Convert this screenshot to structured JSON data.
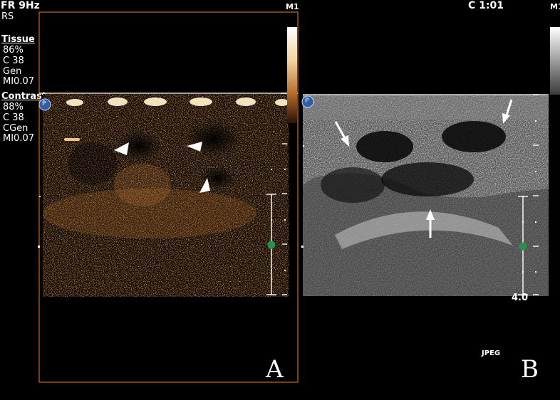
{
  "header": {
    "frame_rate": "FR 9Hz",
    "clock": "C 1:01",
    "marker_left": "M1",
    "marker_right": "M1"
  },
  "settings": {
    "rs": "RS",
    "tissue_title": "Tissue",
    "tissue_lines": [
      "86%",
      "C 38",
      "Gen",
      "MI0.07"
    ],
    "contrast_title": "Contrast",
    "contrast_lines": [
      "88%",
      "C 38",
      "CGen",
      "MI0.07"
    ]
  },
  "panel_a": {
    "label": "A",
    "probe_badge": "P",
    "annotation_icons": [
      "arrowhead-icon",
      "arrowhead-icon",
      "arrowhead-icon"
    ]
  },
  "panel_b": {
    "label": "B",
    "probe_badge": "P",
    "depth_value": "4.0",
    "format_label": "JPEG",
    "annotation_icons": [
      "arrow-icon",
      "arrow-icon",
      "arrow-icon"
    ]
  },
  "colors": {
    "background": "#000000",
    "frame_orange": "#c8691f",
    "probe_blue": "#2f5da8",
    "focus_marker_green": "#2c8f4c",
    "contrast_tint": "#b86a2a"
  }
}
